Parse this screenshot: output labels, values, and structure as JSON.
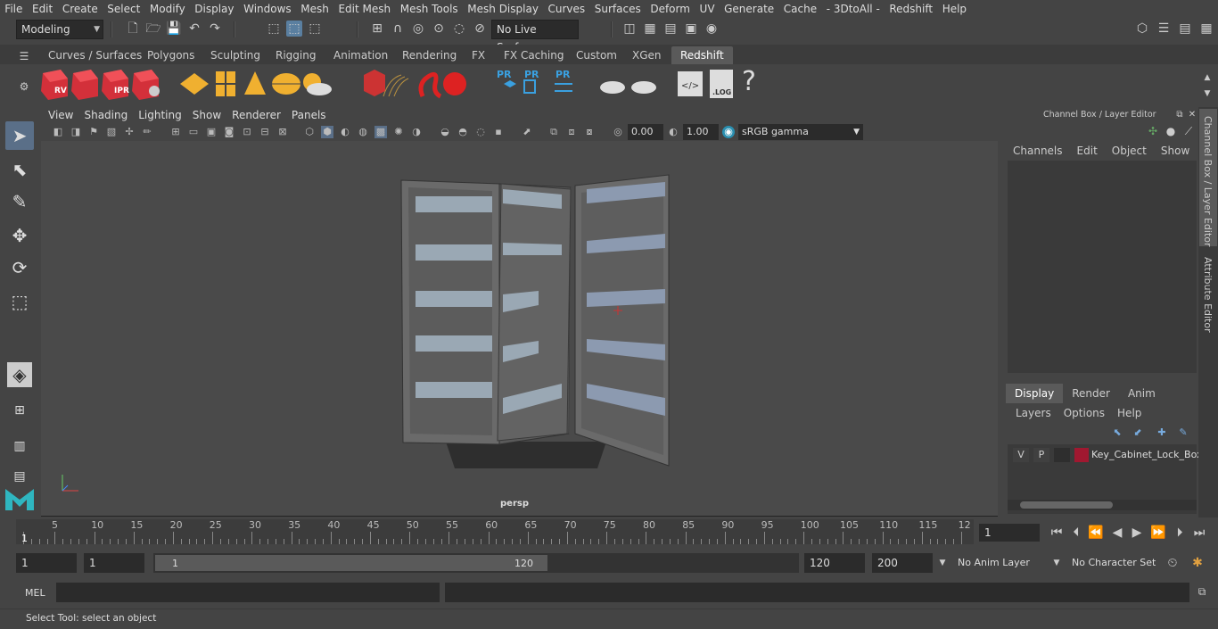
{
  "menubar": [
    "File",
    "Edit",
    "Create",
    "Select",
    "Modify",
    "Display",
    "Windows",
    "Mesh",
    "Edit Mesh",
    "Mesh Tools",
    "Mesh Display",
    "Curves",
    "Surfaces",
    "Deform",
    "UV",
    "Generate",
    "Cache",
    "- 3DtoAll -",
    "Redshift",
    "Help"
  ],
  "toolbar": {
    "mode": "Modeling",
    "live_surface": "No Live Surface"
  },
  "shelf_tabs": [
    "Curves / Surfaces",
    "Polygons",
    "Sculpting",
    "Rigging",
    "Animation",
    "Rendering",
    "FX",
    "FX Caching",
    "Custom",
    "XGen",
    "Redshift"
  ],
  "shelf_active": "Redshift",
  "shelf_icons": {
    "rv": "RV",
    "ipr": "IPR",
    "pr1": "PR",
    "pr2": "PR",
    "pr3": "PR",
    "log": ".LOG",
    "help": "?"
  },
  "viewport": {
    "menu": [
      "View",
      "Shading",
      "Lighting",
      "Show",
      "Renderer",
      "Panels"
    ],
    "exposure": "0.00",
    "gamma": "1.00",
    "color_space": "sRGB gamma",
    "camera_label": "persp"
  },
  "channel_box": {
    "title": "Channel Box / Layer Editor",
    "menu": [
      "Channels",
      "Edit",
      "Object",
      "Show"
    ],
    "layer_tabs": [
      "Display",
      "Render",
      "Anim"
    ],
    "layer_menu": [
      "Layers",
      "Options",
      "Help"
    ],
    "layer": {
      "v": "V",
      "p": "P",
      "name": "Key_Cabinet_Lock_Box",
      "color": "#a01830"
    }
  },
  "side_tabs": [
    "Channel Box / Layer Editor",
    "Attribute Editor"
  ],
  "timeline": {
    "ticks": [
      "5",
      "10",
      "15",
      "20",
      "25",
      "30",
      "35",
      "40",
      "45",
      "50",
      "55",
      "60",
      "65",
      "70",
      "75",
      "80",
      "85",
      "90",
      "95",
      "100",
      "105",
      "110",
      "115",
      "12"
    ],
    "start_marker": "1",
    "current_frame": "1"
  },
  "range": {
    "start": "1",
    "playback_start": "1",
    "slider_start": "1",
    "slider_end": "120",
    "playback_end": "120",
    "end": "200",
    "anim_layer": "No Anim Layer",
    "character_set": "No Character Set"
  },
  "mel": {
    "label": "MEL"
  },
  "help": {
    "text": "Select Tool: select an object"
  }
}
